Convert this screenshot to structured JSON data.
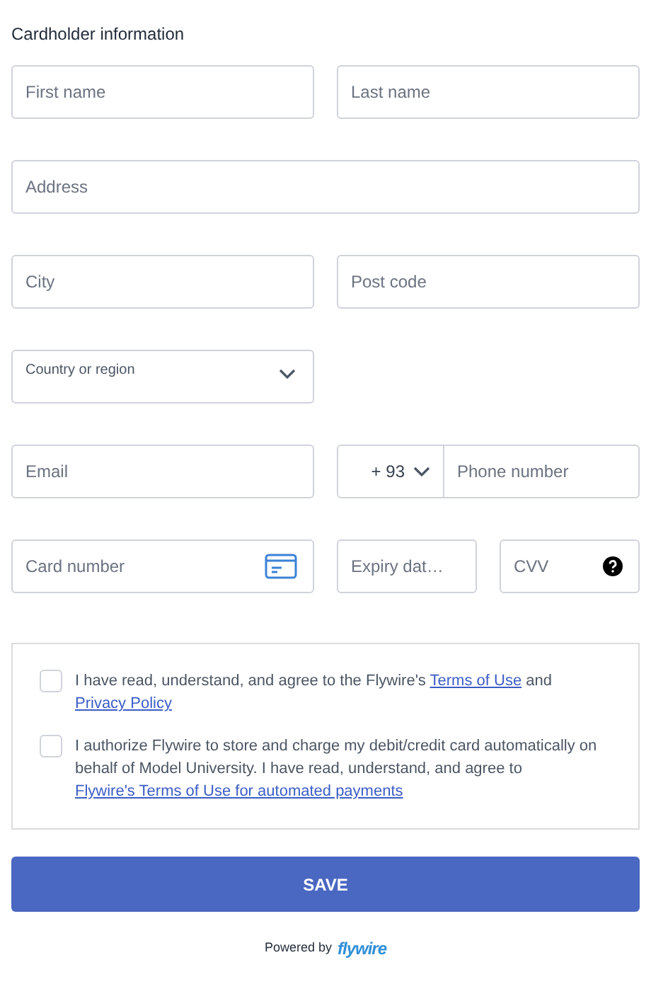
{
  "section_title": "Cardholder information",
  "fields": {
    "first_name": {
      "placeholder": "First name"
    },
    "last_name": {
      "placeholder": "Last name"
    },
    "address": {
      "placeholder": "Address"
    },
    "city": {
      "placeholder": "City"
    },
    "post_code": {
      "placeholder": "Post code"
    },
    "country": {
      "label": "Country or region"
    },
    "email": {
      "placeholder": "Email"
    },
    "phone_code": {
      "value": "+ 93"
    },
    "phone": {
      "placeholder": "Phone number"
    },
    "card_number": {
      "placeholder": "Card number"
    },
    "expiry": {
      "placeholder": "Expiry dat…"
    },
    "cvv": {
      "placeholder": "CVV"
    }
  },
  "consents": [
    {
      "checked": false,
      "parts": [
        {
          "kind": "text",
          "text": "I have read, understand, and agree to the Flywire's "
        },
        {
          "kind": "link",
          "text": "Terms of Use"
        },
        {
          "kind": "text",
          "text": " and "
        },
        {
          "kind": "link",
          "text": "Privacy Policy"
        }
      ]
    },
    {
      "checked": false,
      "parts": [
        {
          "kind": "text",
          "text": "I authorize Flywire to store and charge my debit/credit card automatically on behalf of Model University. I have read, understand, and agree to "
        },
        {
          "kind": "link",
          "text": "Flywire's Terms of Use for automated payments"
        }
      ]
    }
  ],
  "save_button": "SAVE",
  "footer": {
    "powered_by": "Powered by",
    "logo": "flywire"
  }
}
